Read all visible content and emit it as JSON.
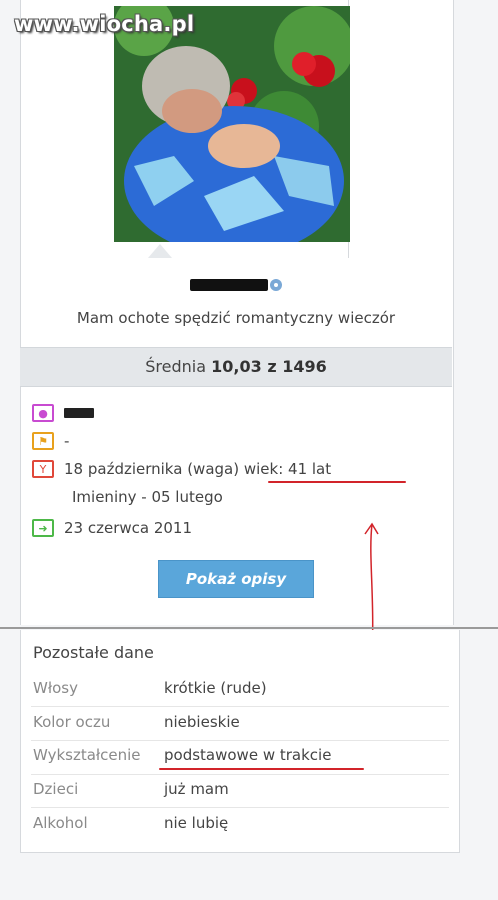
{
  "watermark": "www.wiocha.pl",
  "profile": {
    "username_visible_tail": "",
    "tagline": "Mam ochote spędzić romantyczny wieczór"
  },
  "rating": {
    "label": "Średnia",
    "value": "10,03 z 1496"
  },
  "info": {
    "name_row_text": "",
    "location_row_text": "-",
    "birthday_text": "18 października (waga)",
    "age_text": "wiek: 41 lat",
    "nameday_text": "Imieniny - 05 lutego",
    "joined_text": "23 czerwca 2011"
  },
  "button": {
    "label": "Pokaż opisy"
  },
  "details": {
    "title": "Pozostałe dane",
    "rows": [
      {
        "label": "Włosy",
        "value": "krótkie (rude)"
      },
      {
        "label": "Kolor oczu",
        "value": "niebieskie"
      },
      {
        "label": "Wykształcenie",
        "value": "podstawowe w trakcie"
      },
      {
        "label": "Dzieci",
        "value": "już mam"
      },
      {
        "label": "Alkohol",
        "value": "nie lubię"
      }
    ]
  },
  "colors": {
    "accent_blue": "#5aa6da",
    "annotation_red": "#d2242a",
    "icon_user": "#c84bd1",
    "icon_flag": "#e8a11d",
    "icon_cocktail": "#e0483a",
    "icon_arrow": "#4db848"
  },
  "icons": {
    "user": "user-icon",
    "flag": "flag-icon",
    "cocktail": "cocktail-icon",
    "arrow": "arrow-right-icon",
    "online": "online-status-icon"
  }
}
